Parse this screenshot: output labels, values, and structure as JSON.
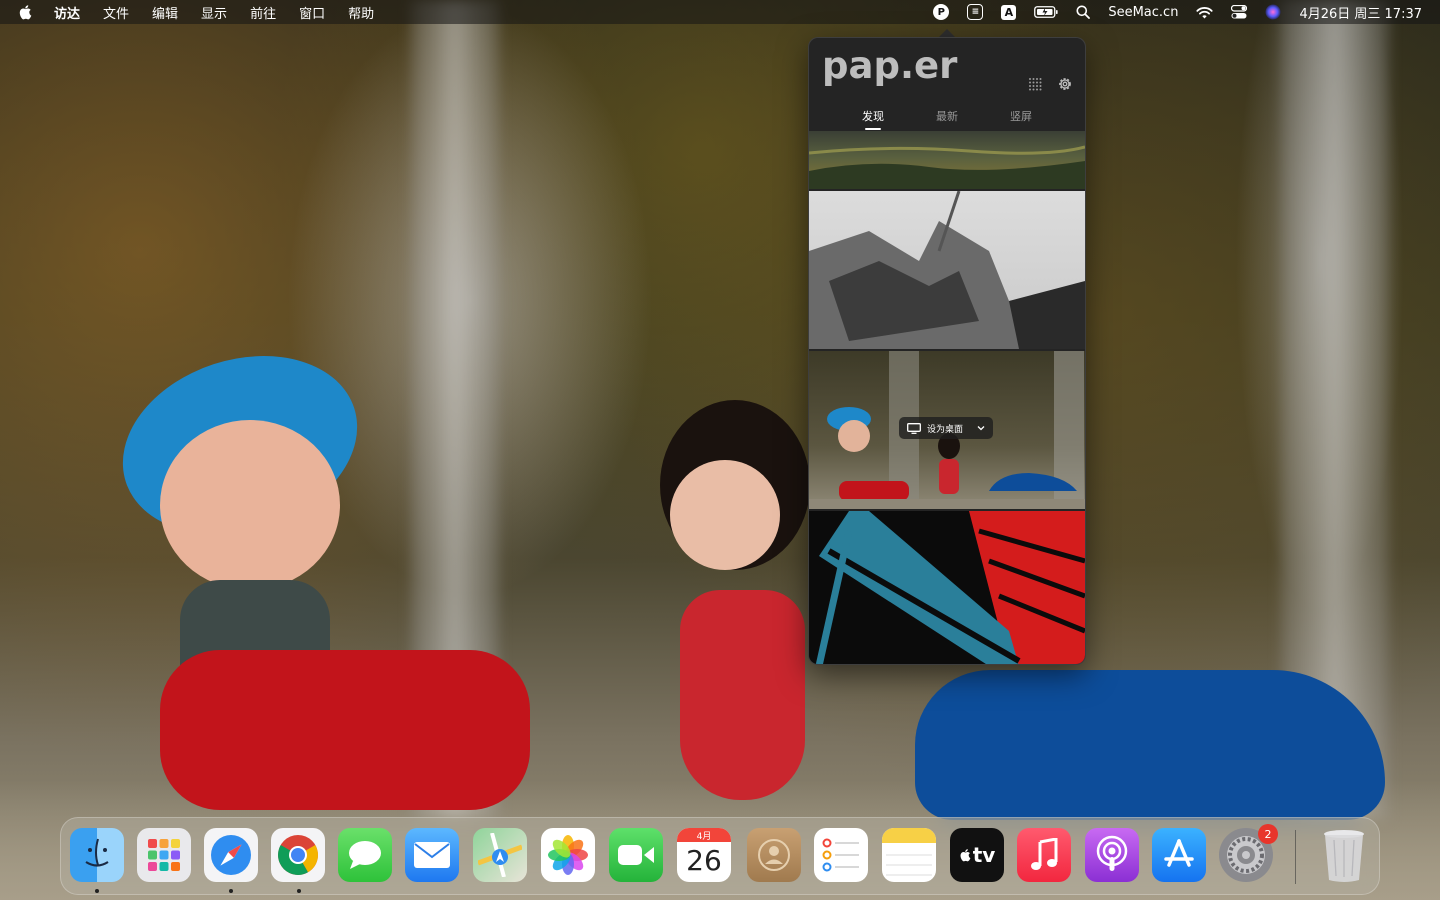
{
  "menubar": {
    "app_menus": [
      "访达",
      "文件",
      "编辑",
      "显示",
      "前往",
      "窗口",
      "帮助"
    ],
    "status": {
      "paper_icon_letter": "P",
      "input_method_letter": "A",
      "site": "SeeMac.cn",
      "clock": "4月26日 周三  17:37"
    }
  },
  "paper_app": {
    "logo": "pap.er",
    "tabs": [
      {
        "label": "发现",
        "active": true
      },
      {
        "label": "最新",
        "active": false
      },
      {
        "label": "竖屏",
        "active": false
      }
    ],
    "set_wallpaper_label": "设为桌面"
  },
  "dock": {
    "apps": [
      {
        "name": "Finder",
        "icon": "finder-icon",
        "running": true
      },
      {
        "name": "Launchpad",
        "icon": "launchpad-icon",
        "running": false
      },
      {
        "name": "Safari",
        "icon": "safari-icon",
        "running": true
      },
      {
        "name": "Chrome",
        "icon": "chrome-icon",
        "running": true
      },
      {
        "name": "Messages",
        "icon": "messages-icon",
        "running": false
      },
      {
        "name": "Mail",
        "icon": "mail-icon",
        "running": false
      },
      {
        "name": "Maps",
        "icon": "maps-icon",
        "running": false
      },
      {
        "name": "Photos",
        "icon": "photos-icon",
        "running": false
      },
      {
        "name": "FaceTime",
        "icon": "facetime-icon",
        "running": false
      },
      {
        "name": "Calendar",
        "icon": "calendar-icon",
        "running": false
      },
      {
        "name": "Contacts",
        "icon": "contacts-icon",
        "running": false
      },
      {
        "name": "Reminders",
        "icon": "reminders-icon",
        "running": false
      },
      {
        "name": "Notes",
        "icon": "notes-icon",
        "running": false
      },
      {
        "name": "Apple TV",
        "icon": "appletv-icon",
        "running": false
      },
      {
        "name": "Music",
        "icon": "music-icon",
        "running": false
      },
      {
        "name": "Podcasts",
        "icon": "podcasts-icon",
        "running": false
      },
      {
        "name": "App Store",
        "icon": "appstore-icon",
        "running": false
      },
      {
        "name": "System Settings",
        "icon": "settings-icon",
        "running": false
      },
      {
        "name": "Trash",
        "icon": "trash-icon",
        "running": false
      }
    ],
    "calendar_month": "4月",
    "calendar_day": "26",
    "appletv_label": "tv",
    "settings_badge": "2"
  },
  "colors": {
    "popover_bg": "#242424",
    "badge": "#e8352b"
  }
}
